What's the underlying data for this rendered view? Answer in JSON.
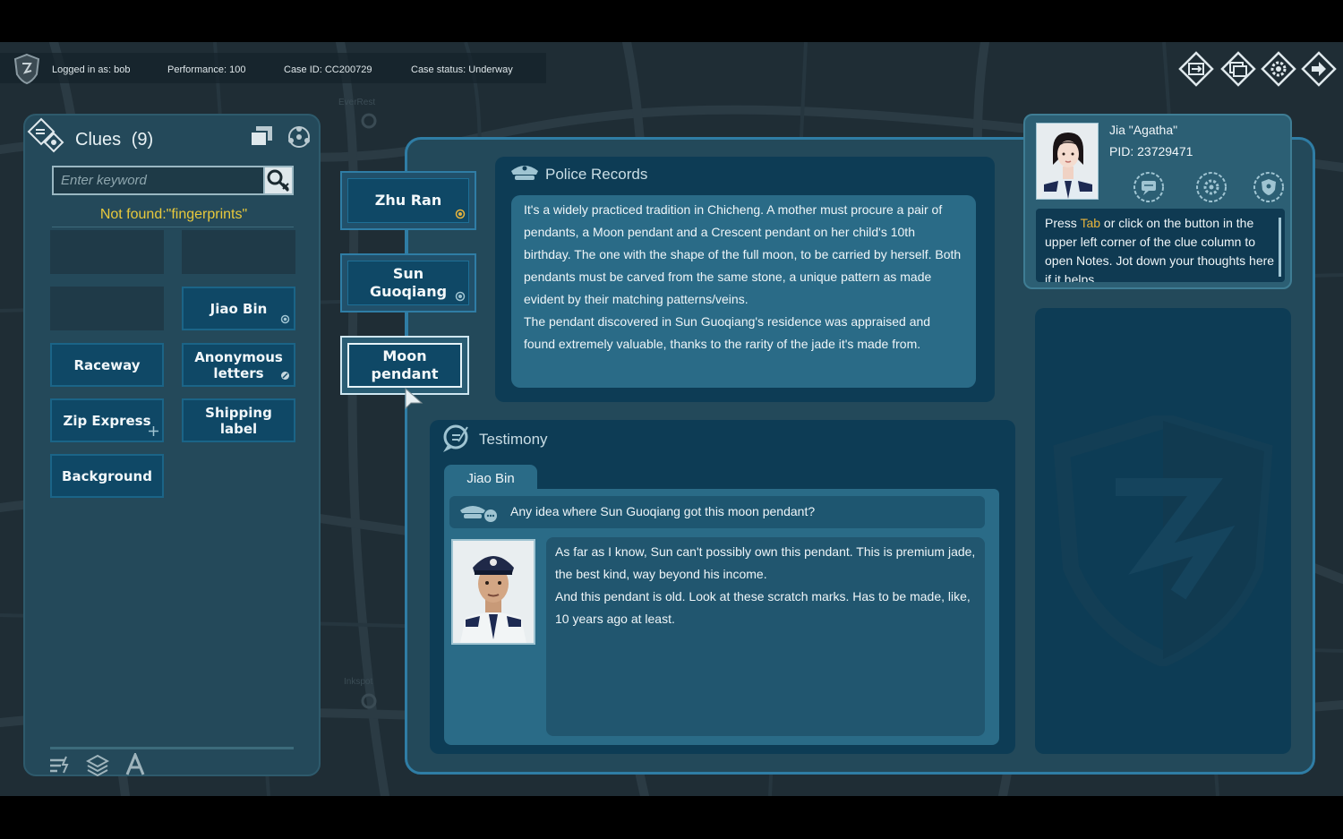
{
  "status_bar": {
    "logged_in": "Logged in as: bob",
    "performance": "Performance: 100",
    "case_id": "Case ID: CC200729",
    "case_status": "Case status: Underway"
  },
  "top_right_icons": [
    "file-transfer-icon",
    "screens-icon",
    "gear-icon",
    "exit-icon"
  ],
  "map_labels": {
    "top": "EverRest",
    "bottom": "Inkspot"
  },
  "clues_panel": {
    "title": "Clues",
    "count": "(9)",
    "search_placeholder": "Enter keyword",
    "not_found": "Not found:\"fingerprints\"",
    "items": [
      {
        "label": "",
        "empty": true
      },
      {
        "label": "",
        "empty": true
      },
      {
        "label": "",
        "empty": true
      },
      {
        "label": "Jiao Bin",
        "empty": false,
        "marker": "dot"
      },
      {
        "label": "Raceway",
        "empty": false,
        "marker": ""
      },
      {
        "label": "Anonymous letters",
        "empty": false,
        "marker": "link"
      },
      {
        "label": "Zip Express",
        "empty": false,
        "marker": "move"
      },
      {
        "label": "Shipping label",
        "empty": false,
        "marker": ""
      },
      {
        "label": "Background",
        "empty": false,
        "marker": ""
      }
    ]
  },
  "selector_tabs": [
    {
      "label": "Zhu Ran",
      "marker": "dot"
    },
    {
      "label": "Sun Guoqiang",
      "marker": "dot"
    },
    {
      "label": "Moon pendant",
      "marker": "",
      "active": true
    }
  ],
  "police_records": {
    "title": "Police Records",
    "text": "It's a widely practiced tradition in Chicheng. A mother must procure a pair of pendants, a Moon pendant and a Crescent pendant on her child's 10th birthday. The one with the shape of the full moon, to be carried by herself. Both pendants must be carved from the same stone, a unique pattern as made evident by their matching patterns/veins.\nThe pendant discovered in Sun Guoqiang's residence was appraised and found extremely valuable, thanks to the rarity of the jade it's made from."
  },
  "testimony": {
    "title": "Testimony",
    "witness": "Jiao Bin",
    "question": "Any idea where Sun Guoqiang got this moon pendant?",
    "answer": "As far as I know, Sun can't possibly own this pendant. This is premium jade, the best kind, way beyond his income.\nAnd this pendant is old. Look at these scratch marks. Has to be made, like, 10 years ago at least."
  },
  "profile": {
    "name": "Jia \"Agatha\"",
    "pid": "PID: 23729471",
    "tip_before": "Press ",
    "tip_key": "Tab",
    "tip_after": " or click on the button in the upper left corner of the clue column to open Notes. Jot down your thoughts here if it helps."
  },
  "colors": {
    "accent": "#2f7da5",
    "highlight": "#e8c93c",
    "panel": "#24495a",
    "card": "#0d3c55"
  }
}
